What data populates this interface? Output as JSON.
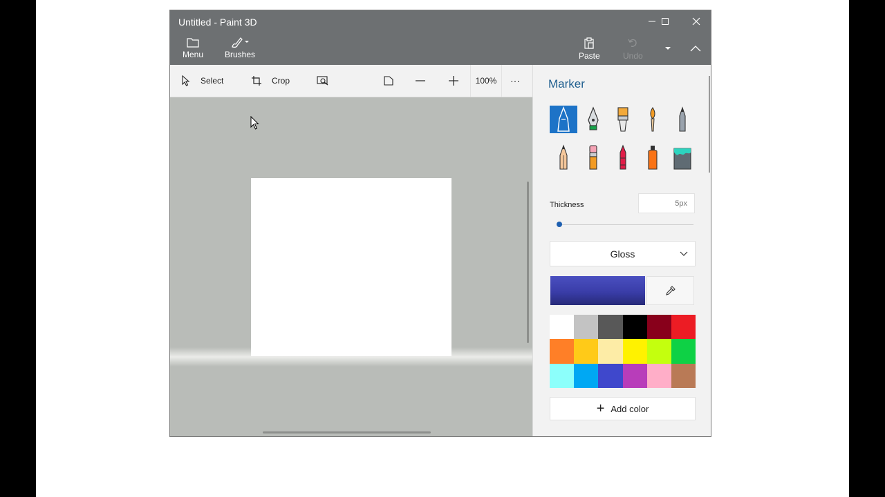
{
  "window": {
    "title": "Untitled - Paint 3D"
  },
  "titlebar": {
    "menu_label": "Menu",
    "brushes_label": "Brushes",
    "paste_label": "Paste",
    "undo_label": "Undo"
  },
  "toolbar": {
    "select_label": "Select",
    "crop_label": "Crop",
    "zoom_level": "100%",
    "more_label": "···"
  },
  "panel": {
    "title": "Marker",
    "brushes": [
      {
        "name": "marker",
        "selected": true
      },
      {
        "name": "calligraphy-pen",
        "selected": false
      },
      {
        "name": "oil-brush",
        "selected": false
      },
      {
        "name": "watercolor",
        "selected": false
      },
      {
        "name": "pixel-pen",
        "selected": false
      },
      {
        "name": "pencil",
        "selected": false
      },
      {
        "name": "eraser",
        "selected": false
      },
      {
        "name": "crayon",
        "selected": false
      },
      {
        "name": "spray-can",
        "selected": false
      },
      {
        "name": "fill",
        "selected": false
      }
    ],
    "thickness_label": "Thickness",
    "thickness_value": "5px",
    "thickness_level": 0.02,
    "finish_label": "Gloss",
    "current_color": "#3a3da8",
    "palette": [
      "#ffffff",
      "#c3c3c3",
      "#585858",
      "#000000",
      "#88001b",
      "#ec1c24",
      "#ff7f27",
      "#ffca18",
      "#fdeca6",
      "#fff200",
      "#c4ff0e",
      "#0ed145",
      "#8cfffb",
      "#00a8f3",
      "#3f48cc",
      "#b83dba",
      "#ffaec8",
      "#b97a56"
    ],
    "add_color_label": "Add color"
  }
}
